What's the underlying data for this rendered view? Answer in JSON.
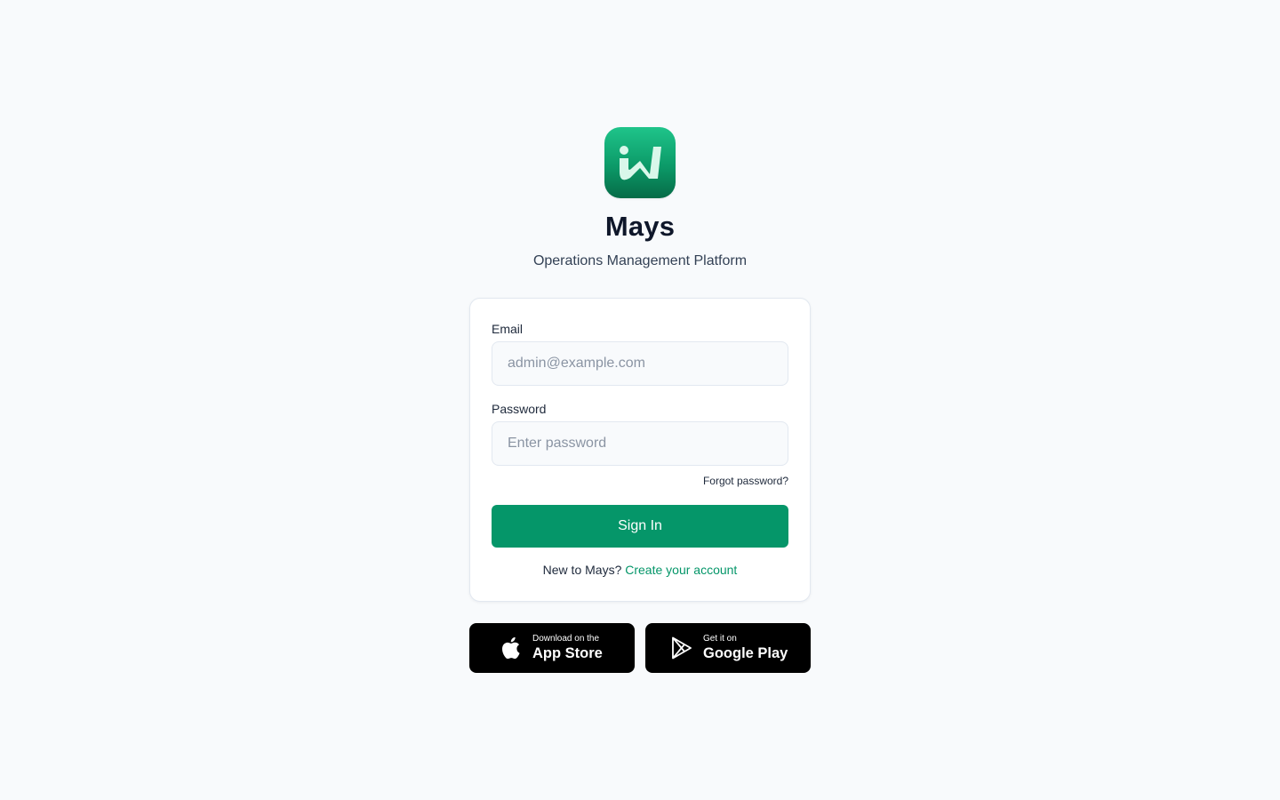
{
  "brand": {
    "app_name": "Mays",
    "tagline": "Operations Management Platform"
  },
  "login": {
    "email_label": "Email",
    "email_placeholder": "admin@example.com",
    "email_value": "",
    "password_label": "Password",
    "password_placeholder": "Enter password",
    "password_value": "",
    "forgot_label": "Forgot password?",
    "signin_label": "Sign In",
    "signup_prompt": "New to Mays?",
    "signup_link": "Create your account"
  },
  "stores": {
    "appstore_small": "Download on the",
    "appstore_big": "App Store",
    "googleplay_small": "Get it on",
    "googleplay_big": "Google Play"
  },
  "icons": {
    "logo": "mays-logo-icon",
    "apple": "apple-icon",
    "google_play": "google-play-icon"
  },
  "colors": {
    "accent": "#059669",
    "background": "#f8fafc",
    "store_button": "#000000"
  }
}
